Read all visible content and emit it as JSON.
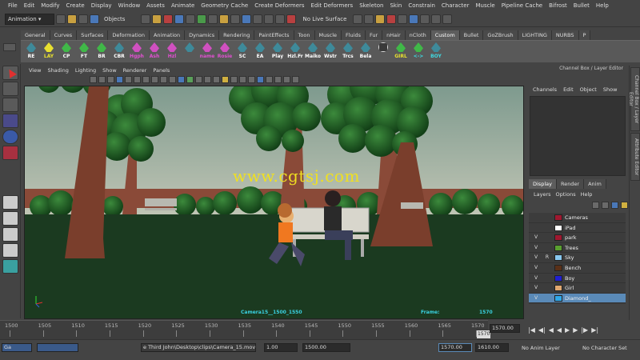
{
  "menubar": [
    "File",
    "Edit",
    "Modify",
    "Create",
    "Display",
    "Window",
    "Assets",
    "Animate",
    "Geometry Cache",
    "Create Deformers",
    "Edit Deformers",
    "Skeleton",
    "Skin",
    "Constrain",
    "Character",
    "Muscle",
    "Pipeline Cache",
    "Bifrost",
    "Bullet",
    "Help"
  ],
  "status": {
    "mode": "Animation",
    "objects_label": "Objects",
    "live_surface": "No Live Surface"
  },
  "shelf_tabs": [
    "General",
    "Curves",
    "Surfaces",
    "Deformation",
    "Animation",
    "Dynamics",
    "Rendering",
    "PaintEffects",
    "Toon",
    "Muscle",
    "Fluids",
    "Fur",
    "nHair",
    "nCloth",
    "Custom",
    "Bullet",
    "GoZBrush",
    "LIGHTING",
    "NURBS",
    "P"
  ],
  "shelf_active": "Custom",
  "shelf_buttons": [
    "RE",
    "LAY",
    "CP",
    "FT",
    "BR",
    "CBR",
    "Hgph",
    "Ash",
    "Hzl",
    "",
    "name",
    "Rosie",
    "SC",
    "EA",
    "Play",
    "Hzl.Fr",
    "Maiko",
    "Wstr",
    "Trcs",
    "Bela",
    "",
    "GIRL",
    "<->",
    "BOY"
  ],
  "panel_menu": [
    "View",
    "Shading",
    "Lighting",
    "Show",
    "Renderer",
    "Panels"
  ],
  "viewport": {
    "camera": "Camera15__1500_1550",
    "frame_label": "Frame:",
    "frame_value": "1570",
    "watermark": "www.cgtsj.com"
  },
  "channel_box": {
    "title": "Channel Box / Layer Editor",
    "menu": [
      "Channels",
      "Edit",
      "Object",
      "Show"
    ]
  },
  "side_tabs": [
    "Channel Box / Layer Editor",
    "Attribute Editor"
  ],
  "layer_tabs": [
    "Display",
    "Render",
    "Anim"
  ],
  "layer_active_tab": "Display",
  "layer_menu": [
    "Layers",
    "Options",
    "Help"
  ],
  "layers": [
    {
      "v": "",
      "r": "",
      "name": "Cameras",
      "color": "#a01830"
    },
    {
      "v": "",
      "r": "",
      "name": "iPad",
      "color": "#ffffff"
    },
    {
      "v": "V",
      "r": "",
      "name": "park",
      "color": "#a01830"
    },
    {
      "v": "V",
      "r": "",
      "name": "Trees",
      "color": "#5aa030"
    },
    {
      "v": "V",
      "r": "R",
      "name": "Sky",
      "color": "#88c8f0"
    },
    {
      "v": "V",
      "r": "",
      "name": "Bench",
      "color": "#5a3018"
    },
    {
      "v": "V",
      "r": "",
      "name": "Boy",
      "color": "#2020d0"
    },
    {
      "v": "V",
      "r": "",
      "name": "Girl",
      "color": "#e0a870"
    },
    {
      "v": "V",
      "r": "",
      "name": "Diamond_",
      "color": "#30a8e8"
    }
  ],
  "layer_selected": "Diamond_",
  "timeline": {
    "ticks": [
      "1500",
      "1505",
      "1510",
      "1515",
      "1520",
      "1525",
      "1530",
      "1535",
      "1540",
      "1545",
      "1550",
      "1555",
      "1560",
      "1565",
      "1570"
    ],
    "current": "1570.00",
    "current_marker": "1570"
  },
  "range": {
    "taskbar_label": "Ga",
    "path": "e Third John\\Desktop\\clips\\Camera_15.mov",
    "start": "1.00",
    "inner_start": "1500.00",
    "inner_end": "1570.00",
    "end": "1610.00",
    "anim_layer": "No Anim Layer",
    "char_set": "No Character Set"
  },
  "colors": {
    "accent": "#5a8ab8",
    "hud": "#3ad0e0"
  }
}
